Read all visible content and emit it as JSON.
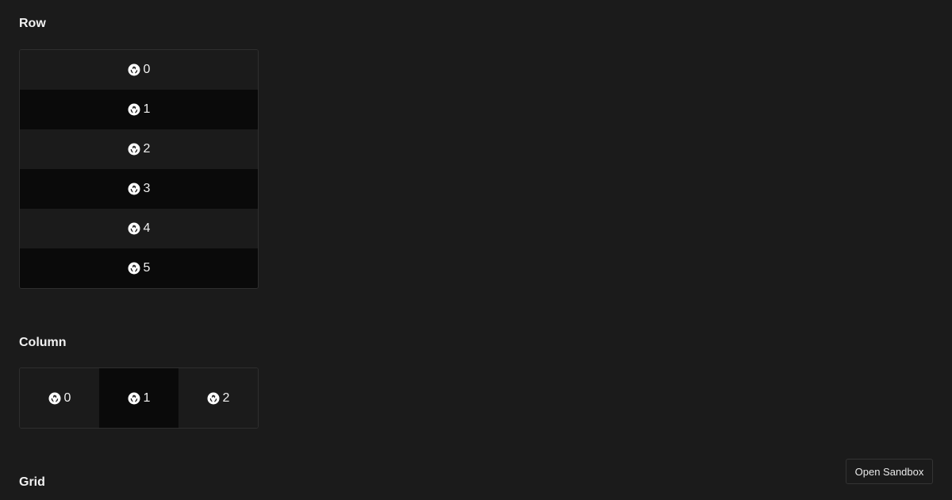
{
  "sections": {
    "row": {
      "title": "Row"
    },
    "column": {
      "title": "Column"
    },
    "grid": {
      "title": "Grid"
    }
  },
  "row_items": [
    {
      "icon": "recycle-icon",
      "label": "0"
    },
    {
      "icon": "recycle-icon",
      "label": "1"
    },
    {
      "icon": "recycle-icon",
      "label": "2"
    },
    {
      "icon": "recycle-icon",
      "label": "3"
    },
    {
      "icon": "recycle-icon",
      "label": "4"
    },
    {
      "icon": "recycle-icon",
      "label": "5"
    }
  ],
  "column_items": [
    {
      "icon": "recycle-icon",
      "label": "0"
    },
    {
      "icon": "recycle-icon",
      "label": "1"
    },
    {
      "icon": "recycle-icon",
      "label": "2"
    }
  ],
  "sandbox_button": {
    "label": "Open Sandbox"
  },
  "colors": {
    "background": "#1b1b1b",
    "alt_row": "#0a0a0a",
    "border": "#2e2e2e",
    "text": "#ffffff"
  }
}
